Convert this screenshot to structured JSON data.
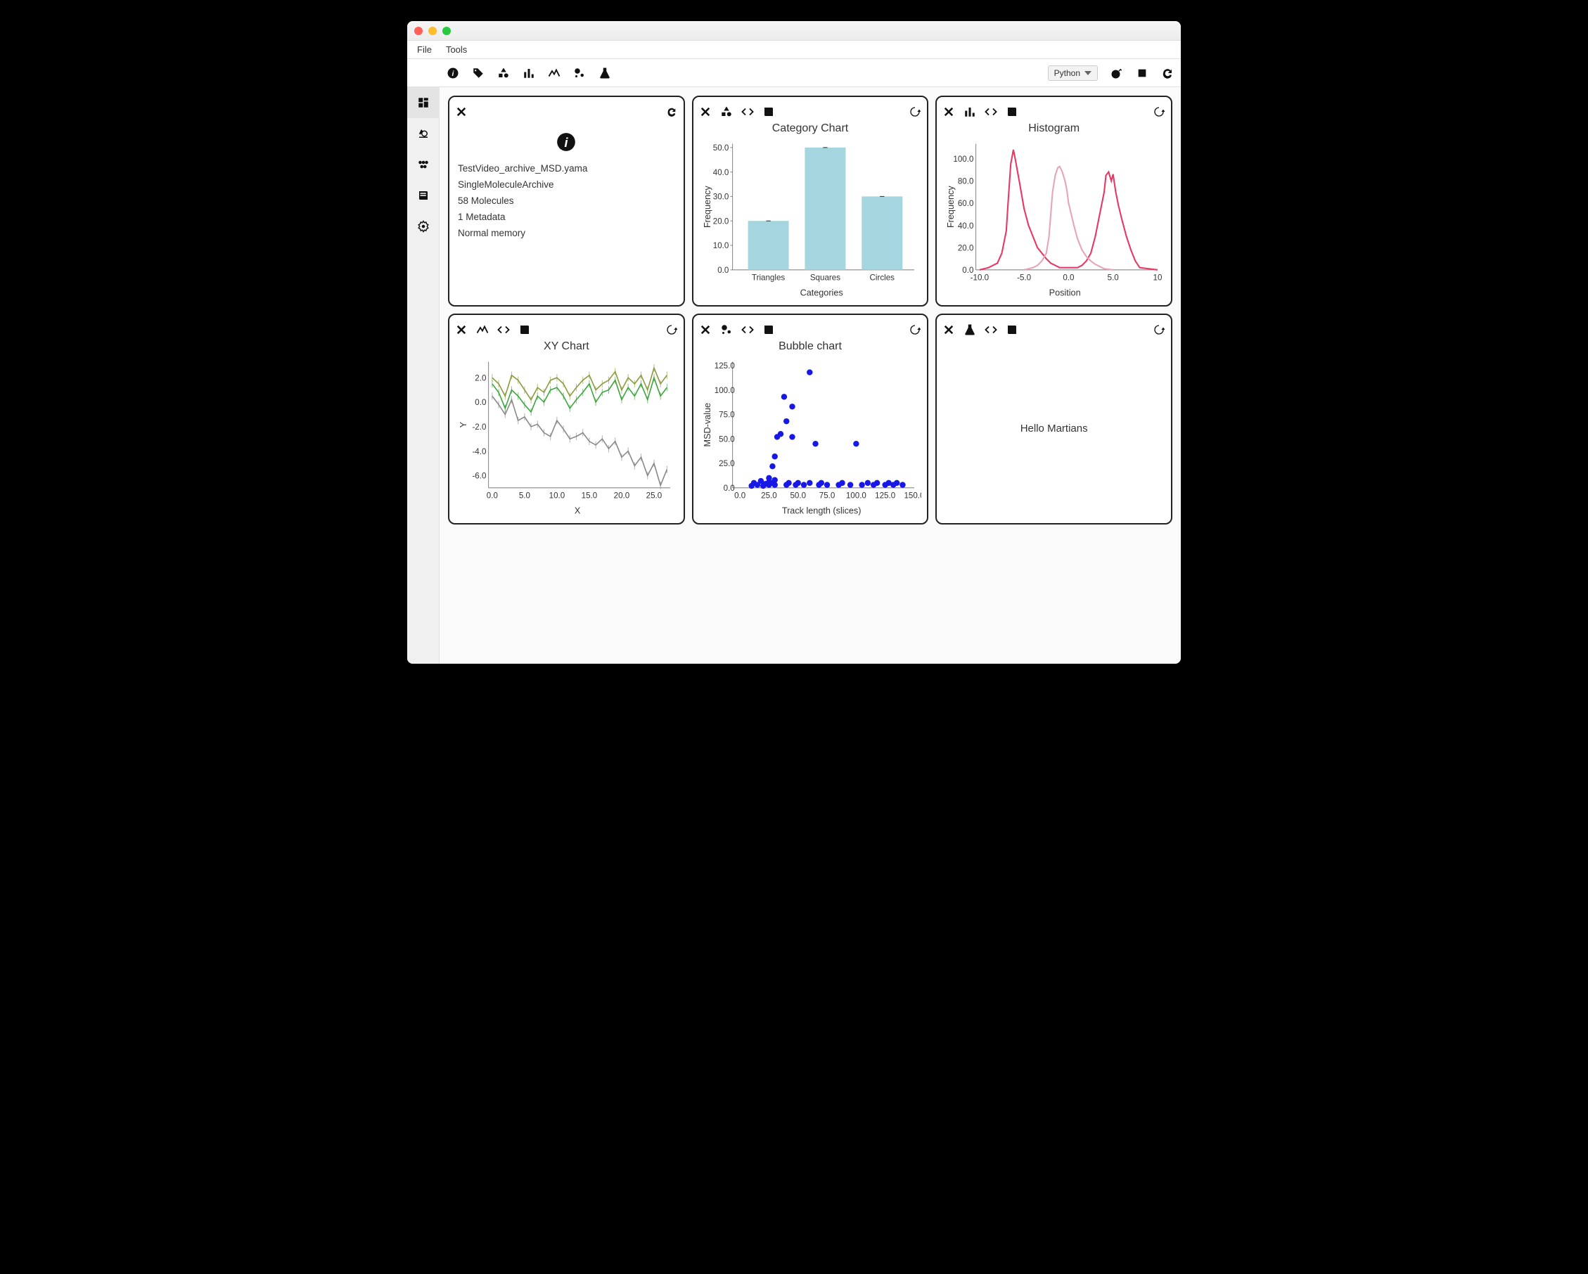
{
  "menubar": {
    "file": "File",
    "tools": "Tools"
  },
  "toolbar": {
    "language": "Python"
  },
  "info_card": {
    "line1": "TestVideo_archive_MSD.yama",
    "line2": "SingleMoleculeArchive",
    "line3": "58 Molecules",
    "line4": "1 Metadata",
    "line5": "Normal memory"
  },
  "category_chart": {
    "title": "Category Chart",
    "xlabel": "Categories",
    "ylabel": "Frequency"
  },
  "histogram": {
    "title": "Histogram",
    "xlabel": "Position",
    "ylabel": "Frequency"
  },
  "xy_chart": {
    "title": "XY Chart",
    "xlabel": "X",
    "ylabel": "Y"
  },
  "bubble_chart": {
    "title": "Bubble chart",
    "xlabel": "Track length (slices)",
    "ylabel": "MSD-value"
  },
  "script_card": {
    "text": "Hello Martians"
  },
  "chart_data": [
    {
      "name": "category_chart",
      "type": "bar",
      "title": "Category Chart",
      "xlabel": "Categories",
      "ylabel": "Frequency",
      "categories": [
        "Triangles",
        "Squares",
        "Circles"
      ],
      "values": [
        20,
        50,
        30
      ],
      "ylim": [
        0,
        50
      ]
    },
    {
      "name": "histogram",
      "type": "line",
      "title": "Histogram",
      "xlabel": "Position",
      "ylabel": "Frequency",
      "xlim": [
        -10,
        10
      ],
      "ylim": [
        0,
        110
      ],
      "series": [
        {
          "name": "red",
          "color": "#e63963",
          "x": [
            -10,
            -9,
            -8.5,
            -8,
            -7.5,
            -7,
            -6.8,
            -6.5,
            -6.2,
            -6,
            -5.5,
            -5,
            -4.5,
            -4,
            -3.5,
            -3,
            -2.5,
            -2,
            -1.5,
            -1,
            1,
            1.5,
            2,
            2.5,
            3,
            3.5,
            4,
            4.2,
            4.5,
            4.8,
            5,
            5.3,
            5.6,
            6,
            6.5,
            7,
            7.5,
            8,
            10
          ],
          "y": [
            0,
            2,
            4,
            6,
            15,
            35,
            60,
            95,
            108,
            100,
            78,
            55,
            40,
            30,
            20,
            15,
            10,
            6,
            4,
            2,
            2,
            4,
            8,
            15,
            30,
            50,
            70,
            85,
            88,
            80,
            86,
            70,
            58,
            45,
            30,
            18,
            8,
            2,
            0
          ]
        },
        {
          "name": "pink",
          "color": "#e8a4b8",
          "x": [
            -5,
            -4,
            -3.5,
            -3,
            -2.5,
            -2.2,
            -2,
            -1.8,
            -1.5,
            -1.2,
            -1,
            -0.7,
            -0.4,
            -0.2,
            0,
            0.3,
            0.6,
            1,
            1.5,
            2,
            2.5,
            3,
            3.5,
            4,
            5
          ],
          "y": [
            0,
            2,
            4,
            8,
            15,
            30,
            50,
            70,
            85,
            92,
            93,
            88,
            80,
            72,
            60,
            50,
            40,
            28,
            18,
            12,
            8,
            5,
            3,
            1,
            0
          ]
        }
      ]
    },
    {
      "name": "xy_chart",
      "type": "line",
      "title": "XY Chart",
      "xlabel": "X",
      "ylabel": "Y",
      "xlim": [
        0,
        27.5
      ],
      "ylim": [
        -7,
        3
      ],
      "series": [
        {
          "name": "olive",
          "color": "#8a9a3a",
          "x": [
            0,
            1,
            2,
            3,
            4,
            5,
            6,
            7,
            8,
            9,
            10,
            11,
            12,
            13,
            14,
            15,
            16,
            17,
            18,
            19,
            20,
            21,
            22,
            23,
            24,
            25,
            26,
            27
          ],
          "y": [
            2.0,
            1.5,
            0.5,
            2.2,
            1.8,
            1.0,
            0.2,
            1.2,
            0.8,
            1.8,
            2.0,
            1.5,
            0.5,
            1.2,
            1.8,
            2.2,
            1.0,
            1.5,
            1.8,
            2.5,
            1.0,
            2.0,
            1.5,
            2.2,
            1.0,
            2.8,
            1.5,
            2.2
          ]
        },
        {
          "name": "green",
          "color": "#3aa53a",
          "x": [
            0,
            1,
            2,
            3,
            4,
            5,
            6,
            7,
            8,
            9,
            10,
            11,
            12,
            13,
            14,
            15,
            16,
            17,
            18,
            19,
            20,
            21,
            22,
            23,
            24,
            25,
            26,
            27
          ],
          "y": [
            1.5,
            0.8,
            -0.5,
            1.0,
            0.5,
            -0.2,
            -0.8,
            0.5,
            0.0,
            1.0,
            1.2,
            0.5,
            -0.5,
            0.2,
            0.8,
            1.5,
            0.0,
            0.8,
            1.0,
            1.8,
            0.2,
            1.2,
            0.5,
            1.5,
            0.2,
            2.0,
            0.5,
            1.2
          ]
        },
        {
          "name": "grey",
          "color": "#888",
          "x": [
            0,
            1,
            2,
            3,
            4,
            5,
            6,
            7,
            8,
            9,
            10,
            11,
            12,
            13,
            14,
            15,
            16,
            17,
            18,
            19,
            20,
            21,
            22,
            23,
            24,
            25,
            26,
            27
          ],
          "y": [
            0.5,
            -0.2,
            -1.0,
            0.2,
            -1.5,
            -1.2,
            -2.0,
            -1.8,
            -2.5,
            -2.8,
            -1.5,
            -2.2,
            -3.0,
            -2.8,
            -2.5,
            -3.2,
            -3.5,
            -3.0,
            -3.8,
            -3.2,
            -4.5,
            -4.0,
            -5.2,
            -4.5,
            -6.0,
            -5.0,
            -6.8,
            -5.5
          ]
        }
      ]
    },
    {
      "name": "bubble_chart",
      "type": "scatter",
      "title": "Bubble chart",
      "xlabel": "Track length (slices)",
      "ylabel": "MSD-value",
      "xlim": [
        0,
        150
      ],
      "ylim": [
        0,
        125
      ],
      "x": [
        10,
        12,
        15,
        18,
        20,
        22,
        25,
        25,
        25,
        28,
        28,
        30,
        30,
        30,
        32,
        35,
        38,
        40,
        40,
        42,
        45,
        45,
        48,
        50,
        55,
        60,
        60,
        65,
        68,
        70,
        75,
        85,
        88,
        95,
        100,
        105,
        110,
        115,
        118,
        125,
        128,
        132,
        135,
        140
      ],
      "y": [
        2,
        5,
        3,
        7,
        2,
        4,
        3,
        10,
        6,
        5,
        22,
        3,
        32,
        8,
        52,
        55,
        93,
        3,
        68,
        5,
        52,
        83,
        3,
        5,
        3,
        5,
        118,
        45,
        3,
        5,
        3,
        3,
        5,
        3,
        45,
        3,
        5,
        3,
        5,
        3,
        5,
        3,
        5,
        3
      ]
    }
  ]
}
